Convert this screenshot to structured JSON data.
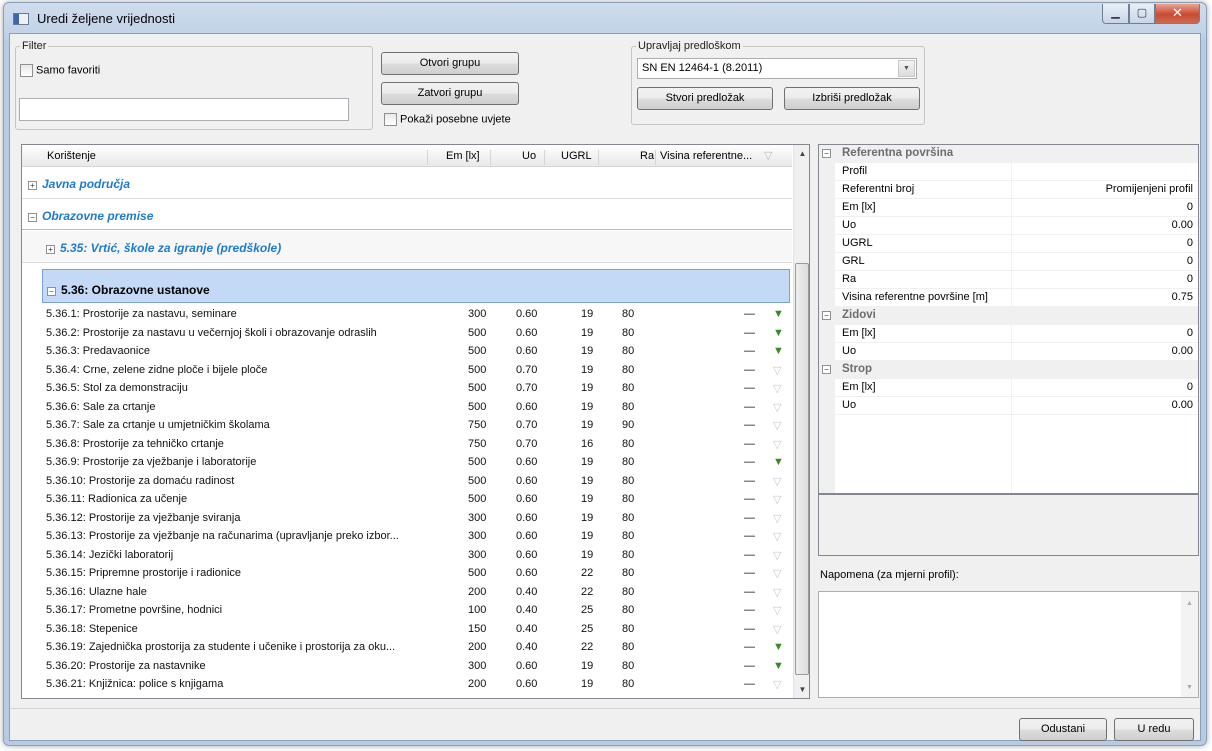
{
  "window": {
    "title": "Uredi željene vrijednosti"
  },
  "filter": {
    "legend": "Filter",
    "favorites_label": "Samo favoriti",
    "search_value": ""
  },
  "groups": {
    "open_label": "Otvori grupu",
    "close_label": "Zatvori grupu",
    "special_label": "Pokaži posebne uvjete"
  },
  "template": {
    "legend": "Upravljaj predloškom",
    "selected": "SN EN 12464-1 (8.2011)",
    "create_label": "Stvori predložak",
    "delete_label": "Izbriši predložak"
  },
  "table": {
    "columns": [
      "Korištenje",
      "Em [lx]",
      "Uo",
      "UGRL",
      "Ra",
      "Visina referentne..."
    ],
    "group_public": "Javna područja",
    "group_edu": "Obrazovne premise",
    "sub_preschool": "5.35: Vrtić, škole za igranje (predškole)",
    "sub_edu": "5.36: Obrazovne ustanove",
    "rows": [
      {
        "name": "5.36.1: Prostorije za nastavu, seminare",
        "em": "300",
        "uo": "0.60",
        "ugrl": "19",
        "ra": "80",
        "h": "—",
        "fav": true
      },
      {
        "name": "5.36.2: Prostorije za nastavu u večernjoj školi i obrazovanje odraslih",
        "em": "500",
        "uo": "0.60",
        "ugrl": "19",
        "ra": "80",
        "h": "—",
        "fav": true
      },
      {
        "name": "5.36.3: Predavaonice",
        "em": "500",
        "uo": "0.60",
        "ugrl": "19",
        "ra": "80",
        "h": "—",
        "fav": true
      },
      {
        "name": "5.36.4: Crne, zelene zidne ploče i bijele ploče",
        "em": "500",
        "uo": "0.70",
        "ugrl": "19",
        "ra": "80",
        "h": "—",
        "fav": false
      },
      {
        "name": "5.36.5: Stol za demonstraciju",
        "em": "500",
        "uo": "0.70",
        "ugrl": "19",
        "ra": "80",
        "h": "—",
        "fav": false
      },
      {
        "name": "5.36.6: Sale za crtanje",
        "em": "500",
        "uo": "0.60",
        "ugrl": "19",
        "ra": "80",
        "h": "—",
        "fav": false
      },
      {
        "name": "5.36.7: Sale za crtanje u umjetničkim školama",
        "em": "750",
        "uo": "0.70",
        "ugrl": "19",
        "ra": "90",
        "h": "—",
        "fav": false
      },
      {
        "name": "5.36.8: Prostorije za tehničko crtanje",
        "em": "750",
        "uo": "0.70",
        "ugrl": "16",
        "ra": "80",
        "h": "—",
        "fav": false
      },
      {
        "name": "5.36.9: Prostorije za vježbanje i laboratorije",
        "em": "500",
        "uo": "0.60",
        "ugrl": "19",
        "ra": "80",
        "h": "—",
        "fav": true
      },
      {
        "name": "5.36.10: Prostorije za domaću radinost",
        "em": "500",
        "uo": "0.60",
        "ugrl": "19",
        "ra": "80",
        "h": "—",
        "fav": false
      },
      {
        "name": "5.36.11: Radionica za učenje",
        "em": "500",
        "uo": "0.60",
        "ugrl": "19",
        "ra": "80",
        "h": "—",
        "fav": false
      },
      {
        "name": "5.36.12: Prostorije za vježbanje sviranja",
        "em": "300",
        "uo": "0.60",
        "ugrl": "19",
        "ra": "80",
        "h": "—",
        "fav": false
      },
      {
        "name": "5.36.13: Prostorije za vježbanje na računarima (upravljanje preko izbor...",
        "em": "300",
        "uo": "0.60",
        "ugrl": "19",
        "ra": "80",
        "h": "—",
        "fav": false
      },
      {
        "name": "5.36.14: Jezički laboratorij",
        "em": "300",
        "uo": "0.60",
        "ugrl": "19",
        "ra": "80",
        "h": "—",
        "fav": false
      },
      {
        "name": "5.36.15: Pripremne prostorije i radionice",
        "em": "500",
        "uo": "0.60",
        "ugrl": "22",
        "ra": "80",
        "h": "—",
        "fav": false
      },
      {
        "name": "5.36.16: Ulazne hale",
        "em": "200",
        "uo": "0.40",
        "ugrl": "22",
        "ra": "80",
        "h": "—",
        "fav": false
      },
      {
        "name": "5.36.17: Prometne površine, hodnici",
        "em": "100",
        "uo": "0.40",
        "ugrl": "25",
        "ra": "80",
        "h": "—",
        "fav": false
      },
      {
        "name": "5.36.18: Stepenice",
        "em": "150",
        "uo": "0.40",
        "ugrl": "25",
        "ra": "80",
        "h": "—",
        "fav": false
      },
      {
        "name": "5.36.19: Zajednička prostorija za studente i učenike i prostorija za oku...",
        "em": "200",
        "uo": "0.40",
        "ugrl": "22",
        "ra": "80",
        "h": "—",
        "fav": true
      },
      {
        "name": "5.36.20: Prostorije za nastavnike",
        "em": "300",
        "uo": "0.60",
        "ugrl": "19",
        "ra": "80",
        "h": "—",
        "fav": true
      },
      {
        "name": "5.36.21: Knjižnica: police s knjigama",
        "em": "200",
        "uo": "0.60",
        "ugrl": "19",
        "ra": "80",
        "h": "—",
        "fav": false
      }
    ]
  },
  "properties": {
    "cat_ref": "Referentna površina",
    "ref_rows": [
      {
        "name": "Profil",
        "value": ""
      },
      {
        "name": "Referentni broj",
        "value": "Promijenjeni profil"
      },
      {
        "name": "Em [lx]",
        "value": "0"
      },
      {
        "name": "Uo",
        "value": "0.00"
      },
      {
        "name": "UGRL",
        "value": "0"
      },
      {
        "name": "GRL",
        "value": "0"
      },
      {
        "name": "Ra",
        "value": "0"
      },
      {
        "name": "Visina referentne površine [m]",
        "value": "0.75"
      }
    ],
    "cat_walls": "Zidovi",
    "wall_rows": [
      {
        "name": "Em [lx]",
        "value": "0"
      },
      {
        "name": "Uo",
        "value": "0.00"
      }
    ],
    "cat_ceiling": "Strop",
    "ceiling_rows": [
      {
        "name": "Em [lx]",
        "value": "0"
      },
      {
        "name": "Uo",
        "value": "0.00"
      }
    ]
  },
  "note": {
    "label": "Napomena (za mjerni profil):",
    "value": ""
  },
  "footer": {
    "cancel_label": "Odustani",
    "ok_label": "U redu"
  },
  "colors": {
    "group_blue": "#1f7bd0",
    "selected_row": "#c4d9f5",
    "flag_green": "#3a8c1c"
  }
}
